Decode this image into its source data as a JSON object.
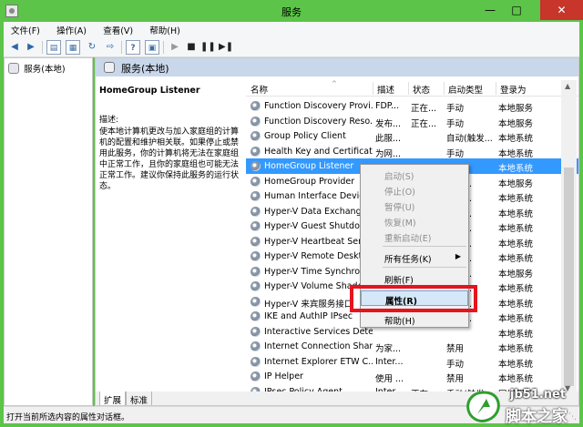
{
  "window": {
    "title": "服务"
  },
  "menu": [
    "文件(F)",
    "操作(A)",
    "查看(V)",
    "帮助(H)"
  ],
  "tree": {
    "root_label": "服务(本地)"
  },
  "panel": {
    "header": "服务(本地)"
  },
  "details": {
    "service_title": "HomeGroup Listener",
    "desc_label": "描述:",
    "desc_text": "使本地计算机更改与加入家庭组的计算机的配置和维护相关联。如果停止或禁用此服务，你的计算机将无法在家庭组中正常工作，且你的家庭组也可能无法正常工作。建议你保持此服务的运行状态。"
  },
  "columns": {
    "name": "名称",
    "desc": "描述",
    "status": "状态",
    "startup": "启动类型",
    "logon": "登录为"
  },
  "rows": [
    {
      "name": "Function Discovery Provi...",
      "desc": "FDP...",
      "status": "正在...",
      "startup": "手动",
      "logon": "本地服务"
    },
    {
      "name": "Function Discovery Reso...",
      "desc": "发布...",
      "status": "正在...",
      "startup": "手动",
      "logon": "本地服务"
    },
    {
      "name": "Group Policy Client",
      "desc": "此服...",
      "status": "",
      "startup": "自动(触发...",
      "logon": "本地系统"
    },
    {
      "name": "Health Key and Certificat...",
      "desc": "为网...",
      "status": "",
      "startup": "手动",
      "logon": "本地系统"
    },
    {
      "name": "HomeGroup Listener",
      "desc": "",
      "status": "",
      "startup": "",
      "logon": "本地系统"
    },
    {
      "name": "HomeGroup Provider",
      "desc": "",
      "status": "",
      "startup": "触发...",
      "logon": "本地服务"
    },
    {
      "name": "Human Interface Device",
      "desc": "",
      "status": "",
      "startup": "触发...",
      "logon": "本地系统"
    },
    {
      "name": "Hyper-V Data Exchange",
      "desc": "",
      "status": "",
      "startup": "触发...",
      "logon": "本地系统"
    },
    {
      "name": "Hyper-V Guest Shutdo",
      "desc": "",
      "status": "",
      "startup": "触发...",
      "logon": "本地系统"
    },
    {
      "name": "Hyper-V Heartbeat Serv",
      "desc": "",
      "status": "",
      "startup": "触发...",
      "logon": "本地系统"
    },
    {
      "name": "Hyper-V Remote Deskt",
      "desc": "",
      "status": "",
      "startup": "触发...",
      "logon": "本地系统"
    },
    {
      "name": "Hyper-V Time Synchro",
      "desc": "",
      "status": "",
      "startup": "触发...",
      "logon": "本地服务"
    },
    {
      "name": "Hyper-V Volume Shado",
      "desc": "",
      "status": "",
      "startup": "触发...",
      "logon": "本地系统"
    },
    {
      "name": "Hyper-V 来宾服务接口",
      "desc": "",
      "status": "",
      "startup": "触发...",
      "logon": "本地系统"
    },
    {
      "name": "IKE and AuthIP IPsec",
      "desc": "",
      "status": "",
      "startup": "触发...",
      "logon": "本地系统"
    },
    {
      "name": "Interactive Services Dete...",
      "desc": "",
      "status": "",
      "startup": "",
      "logon": "本地系统"
    },
    {
      "name": "Internet Connection Shari...",
      "desc": "为家...",
      "status": "",
      "startup": "禁用",
      "logon": "本地系统"
    },
    {
      "name": "Internet Explorer ETW C...",
      "desc": "Inter...",
      "status": "",
      "startup": "手动",
      "logon": "本地系统"
    },
    {
      "name": "IP Helper",
      "desc": "使用 ...",
      "status": "",
      "startup": "禁用",
      "logon": "本地系统"
    },
    {
      "name": "IPsec Policy Agent",
      "desc": "Inter...",
      "status": "正在...",
      "startup": "手动(触发...",
      "logon": "网络服务"
    }
  ],
  "context_menu": {
    "start": "启动(S)",
    "stop": "停止(O)",
    "pause": "暂停(U)",
    "resume": "恢复(M)",
    "restart": "重新启动(E)",
    "all_tasks": "所有任务(K)",
    "refresh": "刷新(F)",
    "properties": "属性(R)",
    "help": "帮助(H)"
  },
  "tabs": [
    "扩展",
    "标准"
  ],
  "statusbar": {
    "text": "打开当前所选内容的属性对话框。"
  },
  "watermark": {
    "site": "jb51.net",
    "brand": "脚本之家"
  },
  "colors": {
    "titlebar": "#5cc448",
    "close": "#c7352b",
    "header": "#c9d7ea",
    "selection": "#3399ff",
    "highlight_box": "#e5141d"
  }
}
